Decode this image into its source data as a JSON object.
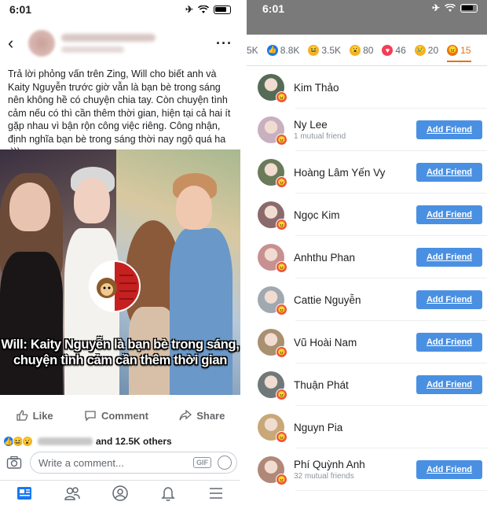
{
  "left": {
    "status": {
      "time": "6:01"
    },
    "post": {
      "text": "Trả lời phỏng vấn trên Zing, Will cho biết anh và Kaity Nguyễn trước giờ vẫn là bạn bè trong sáng nên không hề có chuyện chia tay. Còn chuyện tình cảm nếu có thì cần thêm thời gian, hiện tại cả hai ít gặp nhau vì bận rộn công việc riêng. Công nhận, định nghĩa bạn bè trong sáng thời nay ngộ quá ha :)))",
      "caption_line1": "Will: Kaity Nguyễn là bạn bè trong sáng,",
      "caption_line2": "chuyện tình cảm cần thêm thời gian"
    },
    "actions": {
      "like": "Like",
      "comment": "Comment",
      "share": "Share"
    },
    "reactions_summary": "and 12.5K others",
    "comment_placeholder": "Write a comment...",
    "gif_label": "GIF"
  },
  "right": {
    "status": {
      "time": "6:01"
    },
    "reaction_tabs": [
      {
        "label": "5K",
        "icon": "partial",
        "color": "#606770"
      },
      {
        "label": "8.8K",
        "icon": "like-icon",
        "color": "#1877f2"
      },
      {
        "label": "3.5K",
        "icon": "haha-icon",
        "color": "#f7b125"
      },
      {
        "label": "80",
        "icon": "wow-icon",
        "color": "#f7b125"
      },
      {
        "label": "46",
        "icon": "love-icon",
        "color": "#f33e58"
      },
      {
        "label": "20",
        "icon": "sad-icon",
        "color": "#f7b125"
      },
      {
        "label": "15",
        "icon": "angry-icon",
        "color": "#e9710f"
      }
    ],
    "add_friend_label": "Add Friend",
    "people": [
      {
        "name": "Kim Thảo",
        "mutual": "",
        "has_button": false,
        "avatar_color": "#556b55"
      },
      {
        "name": "Ny Lee",
        "mutual": "1 mutual friend",
        "has_button": true,
        "avatar_color": "#c8b0c0"
      },
      {
        "name": "Hoàng Lâm Yến Vy",
        "mutual": "",
        "has_button": true,
        "avatar_color": "#6a7a5a"
      },
      {
        "name": "Ngọc Kim",
        "mutual": "",
        "has_button": true,
        "avatar_color": "#8a6a6a"
      },
      {
        "name": "Anhthu Phan",
        "mutual": "",
        "has_button": true,
        "avatar_color": "#c89090"
      },
      {
        "name": "Cattie Nguyễn",
        "mutual": "",
        "has_button": true,
        "avatar_color": "#a0a8b0"
      },
      {
        "name": "Vũ Hoài Nam",
        "mutual": "",
        "has_button": true,
        "avatar_color": "#a89070"
      },
      {
        "name": "Thuận Phát",
        "mutual": "",
        "has_button": true,
        "avatar_color": "#707878"
      },
      {
        "name": "Nguyn Pia",
        "mutual": "",
        "has_button": false,
        "avatar_color": "#c8a878"
      },
      {
        "name": "Phí Quỳnh Anh",
        "mutual": "32 mutual friends",
        "has_button": true,
        "avatar_color": "#b08878"
      }
    ]
  }
}
